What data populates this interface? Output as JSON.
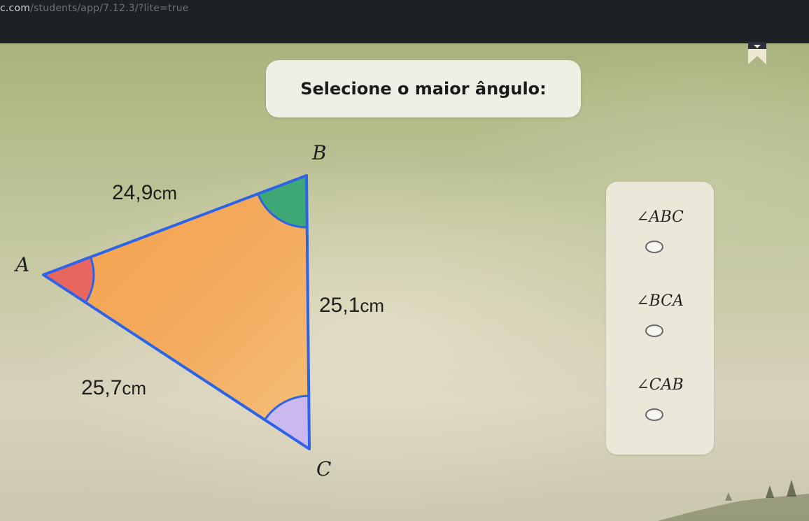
{
  "browser": {
    "url_host": "c.com",
    "url_path": "/students/app/7.12.3/?lite=true"
  },
  "question": {
    "prompt": "Selecione o maior ângulo:"
  },
  "figure": {
    "vertices": {
      "a": "A",
      "b": "B",
      "c": "C"
    },
    "sides": {
      "ab": "24,9",
      "bc": "25,1",
      "ac": "25,7",
      "unit": "cm"
    },
    "colors": {
      "triangle_fill": "#f2a655",
      "triangle_edge": "#2d63e6",
      "angle_a": "#e7665f",
      "angle_b": "#3ea877",
      "angle_c": "#cbb8ee"
    }
  },
  "choices": [
    {
      "label": "∠ABC",
      "selected": false
    },
    {
      "label": "∠BCA",
      "selected": false
    },
    {
      "label": "∠CAB",
      "selected": false
    }
  ],
  "icons": {
    "bookmark": "bookmark-icon"
  }
}
